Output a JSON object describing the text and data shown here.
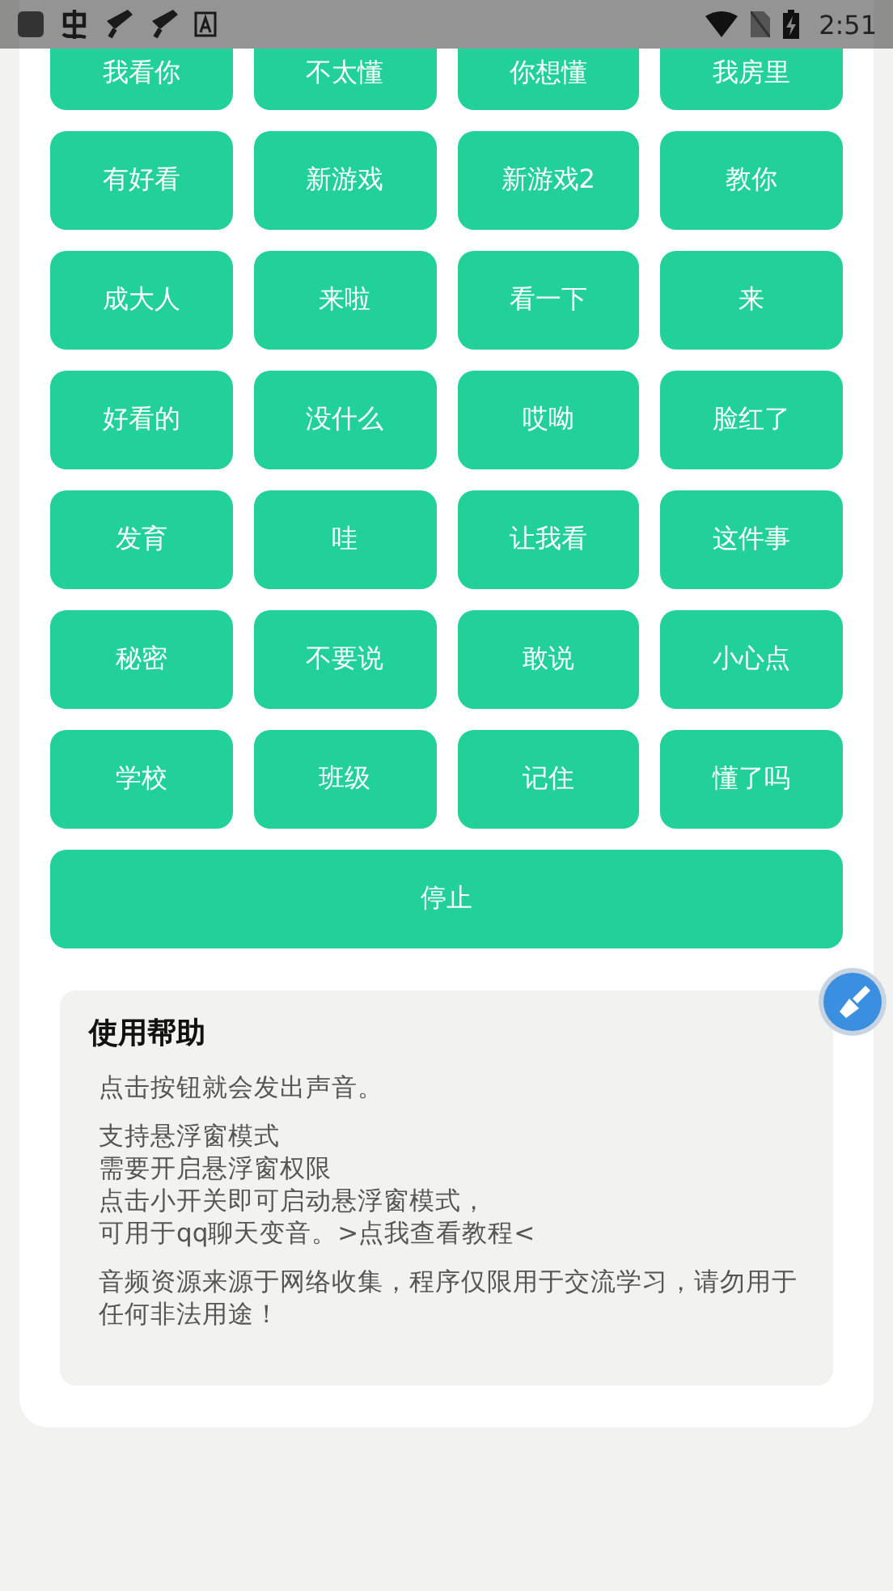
{
  "status_bar": {
    "time": "2:51"
  },
  "sound_buttons": [
    {
      "label": "我看你"
    },
    {
      "label": "不太懂"
    },
    {
      "label": "你想懂"
    },
    {
      "label": "我房里"
    },
    {
      "label": "有好看"
    },
    {
      "label": "新游戏"
    },
    {
      "label": "新游戏2"
    },
    {
      "label": "教你"
    },
    {
      "label": "成大人"
    },
    {
      "label": "来啦"
    },
    {
      "label": "看一下"
    },
    {
      "label": "来"
    },
    {
      "label": "好看的"
    },
    {
      "label": "没什么"
    },
    {
      "label": "哎呦"
    },
    {
      "label": "脸红了"
    },
    {
      "label": "发育"
    },
    {
      "label": "哇"
    },
    {
      "label": "让我看"
    },
    {
      "label": "这件事"
    },
    {
      "label": "秘密"
    },
    {
      "label": "不要说"
    },
    {
      "label": "敢说"
    },
    {
      "label": "小心点"
    },
    {
      "label": "学校"
    },
    {
      "label": "班级"
    },
    {
      "label": "记住"
    },
    {
      "label": "懂了吗"
    }
  ],
  "stop_button": {
    "label": "停止"
  },
  "help": {
    "title": "使用帮助",
    "paragraphs": [
      [
        "点击按钮就会发出声音。"
      ],
      [
        "支持悬浮窗模式",
        "需要开启悬浮窗权限",
        "点击小开关即可启动悬浮窗模式，",
        "可用于qq聊天变音。>点我查看教程<"
      ],
      [
        "音频资源来源于网络收集，程序仅限用于交流学习，请勿用于任何非法用途！"
      ]
    ]
  }
}
